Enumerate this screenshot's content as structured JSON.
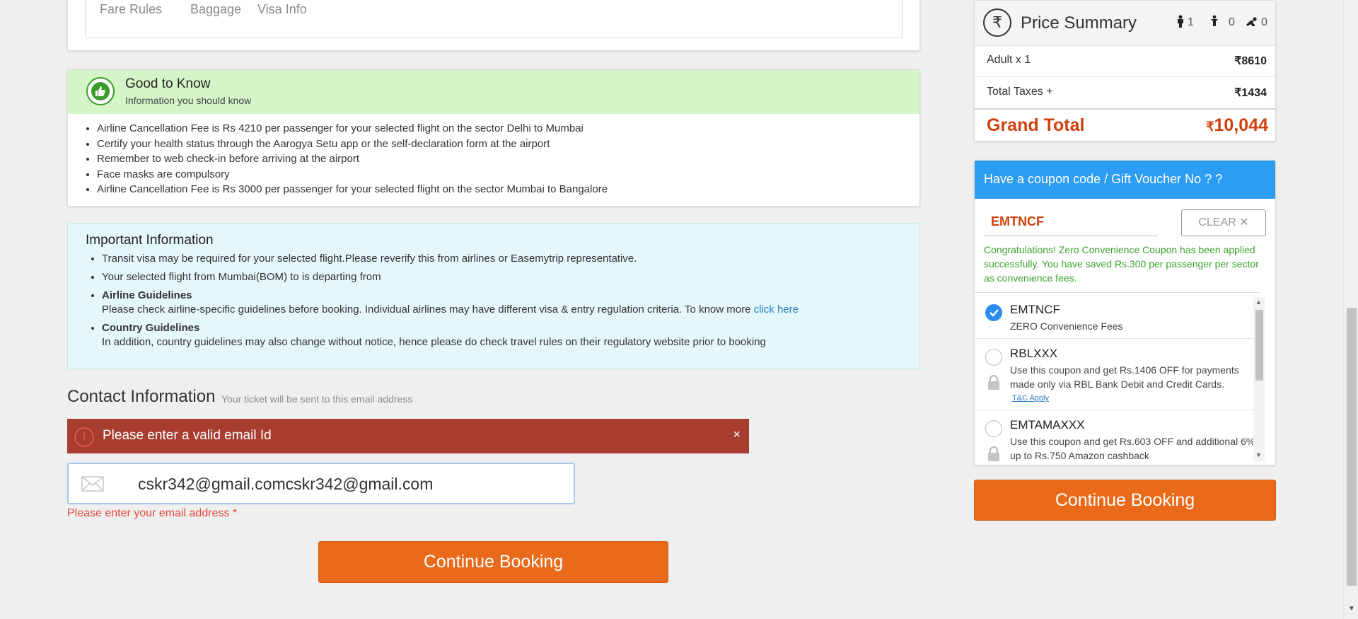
{
  "fare_tabs": [
    "Fare Rules",
    "Baggage",
    "Visa Info"
  ],
  "good_to_know": {
    "title": "Good to Know",
    "subtitle": "Information you should know",
    "items": [
      "Airline Cancellation Fee is Rs 4210 per passenger for your selected flight on the sector Delhi to Mumbai",
      "Certify your health status through the Aarogya Setu app or the self-declaration form at the airport",
      "Remember to web check-in before arriving at the airport",
      "Face masks are compulsory",
      "Airline Cancellation Fee is Rs 3000 per passenger for your selected flight on the sector Mumbai to Bangalore"
    ]
  },
  "important_info": {
    "title": "Important Information",
    "item1": "Transit visa may be required for your selected flight.Please reverify this from airlines or Easemytrip representative.",
    "item2": "Your selected flight from Mumbai(BOM) to is departing from",
    "airline_title": "Airline Guidelines",
    "airline_text": "Please check airline-specific guidelines before booking. Individual airlines may have different visa & entry regulation criteria. To know more",
    "airline_link": "click here",
    "country_title": "Country Guidelines",
    "country_text": "In addition, country guidelines may also change without notice, hence please do check travel rules on their regulatory website prior to booking"
  },
  "contact": {
    "title": "Contact Information",
    "subtitle": "Your ticket will be sent to this email address",
    "error_banner": "Please enter a valid email Id",
    "close_symbol": "×",
    "email_value": "cskr342@gmail.comcskr342@gmail.com",
    "email_error": "Please enter your email address *",
    "continue_label": "Continue Booking"
  },
  "price_summary": {
    "title": "Price Summary",
    "adults": "1",
    "children": "0",
    "infants": "0",
    "rows": [
      {
        "label": "Adult x 1",
        "value": "8610"
      },
      {
        "label": "Total Taxes +",
        "value": "1434"
      }
    ],
    "grand_label": "Grand Total",
    "grand_value": "10,044",
    "currency": "₹"
  },
  "coupon": {
    "header": "Have a coupon code / Gift Voucher No ? ?",
    "code": "EMTNCF",
    "clear_label": "CLEAR ✕",
    "success": "Congratulations! Zero Convenience Coupon has been applied successfully. You have saved Rs.300 per passenger per sector as convenience fees.",
    "items": [
      {
        "code": "EMTNCF",
        "desc": "ZERO Convenience Fees",
        "selected": true
      },
      {
        "code": "RBLXXX",
        "desc": "Use this coupon and get Rs.1406 OFF for payments made only via RBL Bank Debit and Credit Cards.",
        "tc": "T&C Apply"
      },
      {
        "code": "EMTAMAXXX",
        "desc": "Use this coupon and get Rs.603 OFF and additional 6% up to Rs.750 Amazon cashback"
      }
    ]
  },
  "side_continue_label": "Continue Booking",
  "colors": {
    "accent_orange": "#ea6a1b",
    "error_red": "#a63d2f",
    "coupon_blue": "#2d9cf3",
    "success_green": "#3ca32e",
    "total_red": "#d1400c"
  }
}
